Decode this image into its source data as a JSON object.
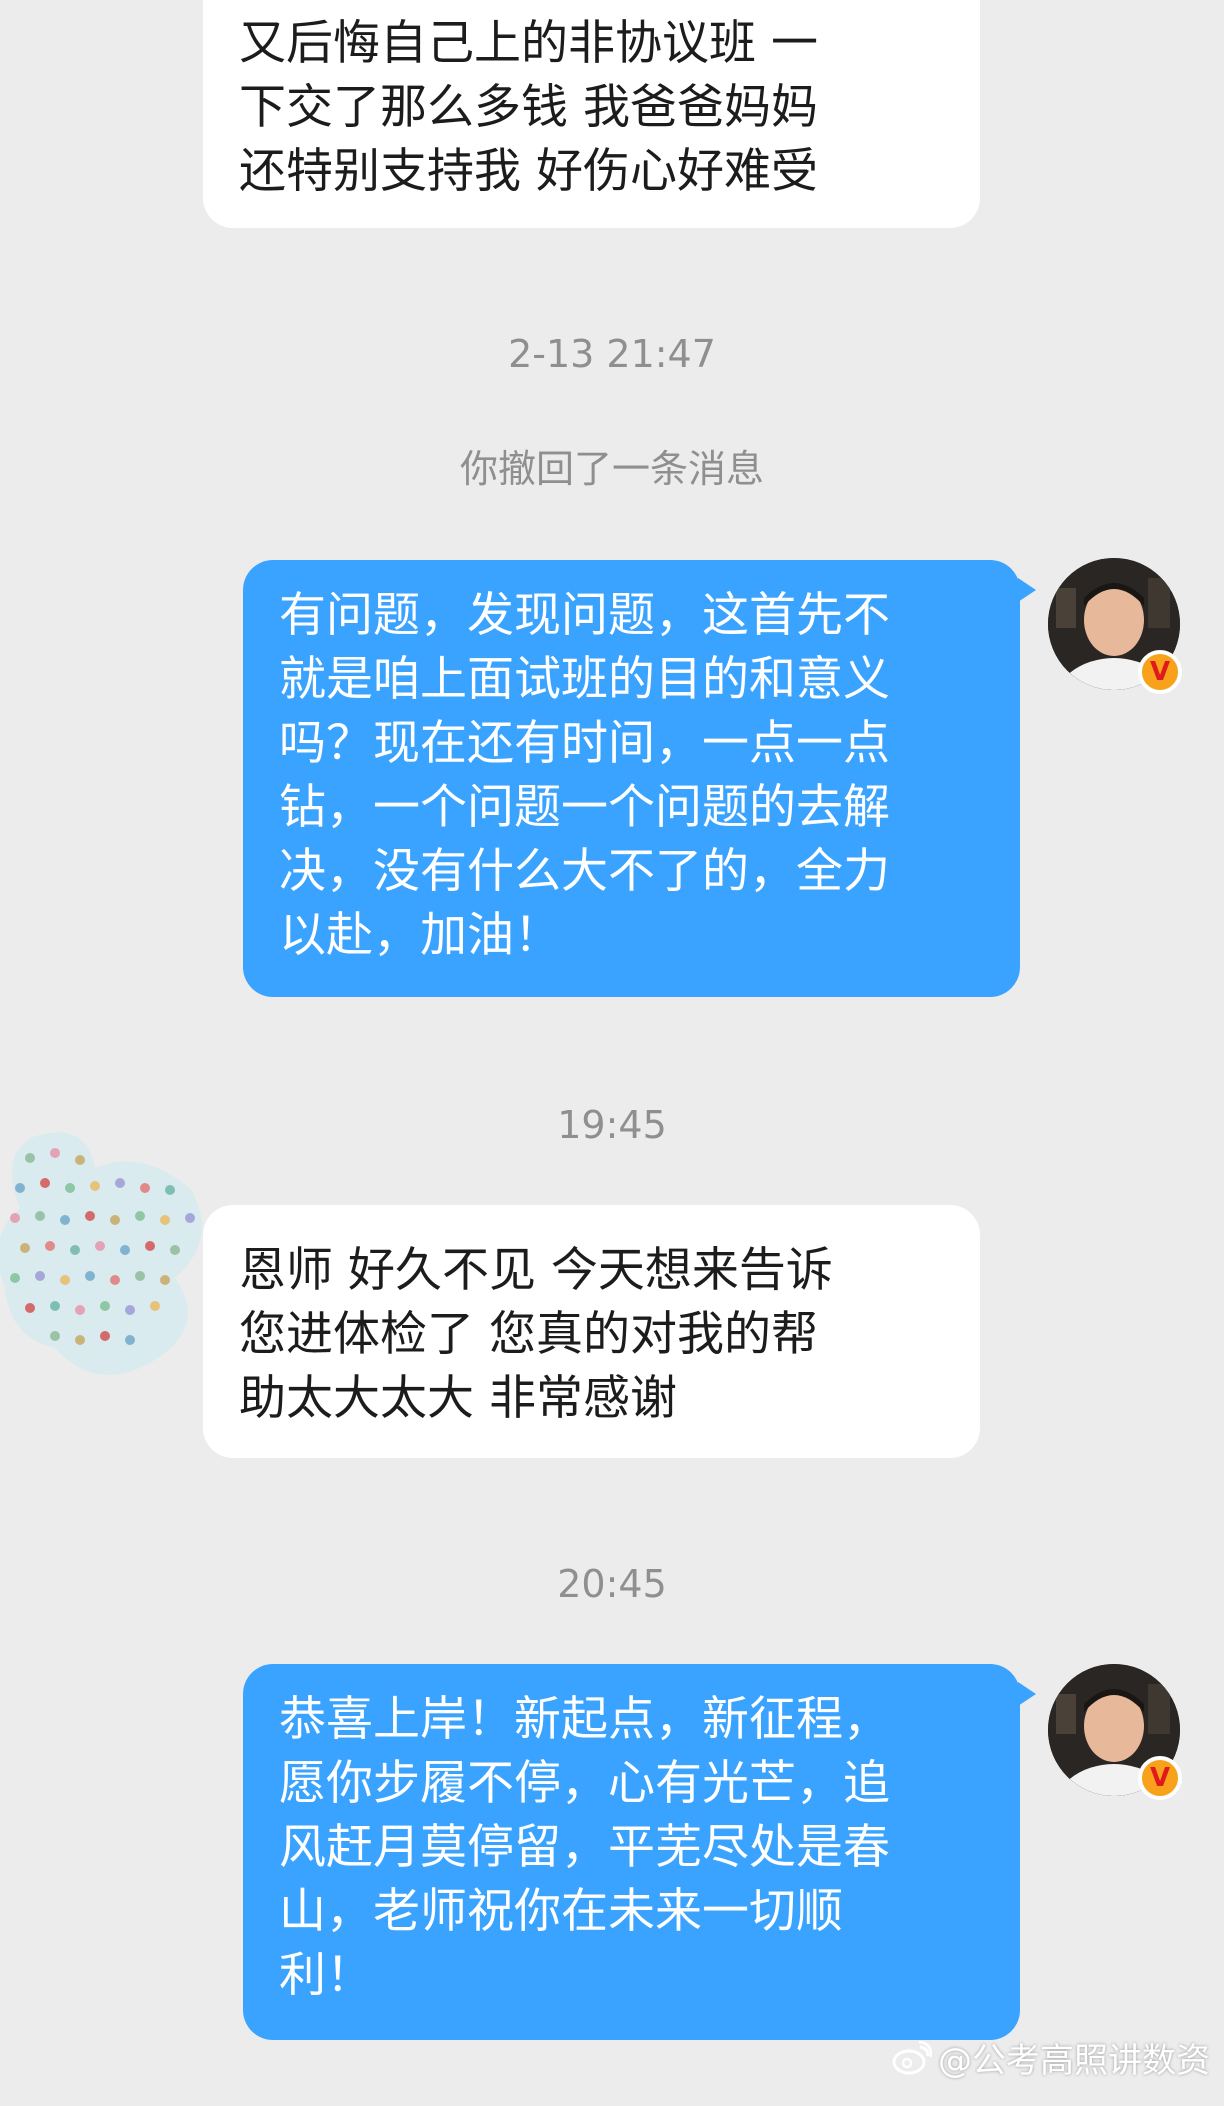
{
  "messages": [
    {
      "id": "msg1",
      "direction": "incoming",
      "lines": [
        "又后悔自己上的非协议班 一",
        "下交了那么多钱 我爸爸妈妈",
        "还特别支持我 好伤心好难受"
      ]
    },
    {
      "id": "ts1",
      "type": "timestamp",
      "text": "2-13 21:47"
    },
    {
      "id": "sys1",
      "type": "system",
      "text": "你撤回了一条消息"
    },
    {
      "id": "msg2",
      "direction": "outgoing",
      "lines": [
        "有问题，发现问题，这首先不",
        "就是咱上面试班的目的和意义",
        "吗？现在还有时间，一点一点",
        "钻，一个问题一个问题的去解",
        "决，没有什么大不了的，全力",
        "以赴，加油！"
      ]
    },
    {
      "id": "ts2",
      "type": "timestamp",
      "text": "19:45"
    },
    {
      "id": "msg3",
      "direction": "incoming",
      "lines": [
        "恩师 好久不见 今天想来告诉",
        "您进体检了 您真的对我的帮",
        "助太大太大 非常感谢"
      ]
    },
    {
      "id": "ts3",
      "type": "timestamp",
      "text": "20:45"
    },
    {
      "id": "msg4",
      "direction": "outgoing",
      "lines": [
        "恭喜上岸！新起点，新征程，",
        "愿你步履不停，心有光芒，追",
        "风赶月莫停留，平芜尽处是春",
        "山，老师祝你在未来一切顺",
        "利！"
      ]
    }
  ],
  "verified_badge": "V",
  "watermark": {
    "icon": "weibo-icon",
    "text": "@公考高照讲数资"
  },
  "colors": {
    "background": "#ececec",
    "incoming_bubble": "#ffffff",
    "outgoing_bubble": "#3aa3ff",
    "timestamp_text": "#8f8f8f",
    "badge": "#f7a21a"
  }
}
